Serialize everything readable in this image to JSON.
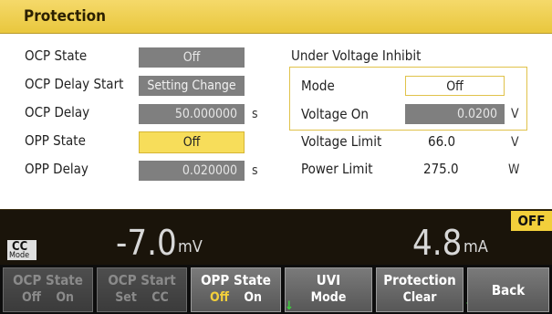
{
  "title": "Protection",
  "left": {
    "ocp_state": {
      "label": "OCP State",
      "value": "Off"
    },
    "ocp_delay_start": {
      "label": "OCP Delay Start",
      "value": "Setting Change"
    },
    "ocp_delay": {
      "label": "OCP Delay",
      "value": "50.000000",
      "unit": "s"
    },
    "opp_state": {
      "label": "OPP State",
      "value": "Off"
    },
    "opp_delay": {
      "label": "OPP Delay",
      "value": "0.020000",
      "unit": "s"
    }
  },
  "uvi": {
    "heading": "Under Voltage Inhibit",
    "mode": {
      "label": "Mode",
      "value": "Off"
    },
    "voltage_on": {
      "label": "Voltage On",
      "value": "0.0200",
      "unit": "V"
    },
    "voltage_limit": {
      "label": "Voltage Limit",
      "value": "66.0",
      "unit": "V"
    },
    "power_limit": {
      "label": "Power Limit",
      "value": "275.0",
      "unit": "W"
    }
  },
  "meter": {
    "mode_top": "CC",
    "mode_bottom": "Mode",
    "voltage": "-7.0",
    "voltage_unit": "mV",
    "current": "4.8",
    "current_unit": "mA",
    "output_state": "OFF"
  },
  "softkeys": [
    {
      "line1": "OCP State",
      "line2a": "Off",
      "line2b": "On"
    },
    {
      "line1": "OCP Start",
      "line2a": "Set",
      "line2b": "CC"
    },
    {
      "line1": "OPP State",
      "line2a": "Off",
      "line2b": "On"
    },
    {
      "line1": "UVI",
      "line2": "Mode"
    },
    {
      "line1": "Protection",
      "line2": "Clear"
    },
    {
      "line1": "Back"
    }
  ],
  "colors": {
    "accent_yellow": "#f2cf3b",
    "field_gray": "#7f7f7f",
    "arrow_green": "#3cd23c"
  },
  "icons": {
    "down_arrow": "↓",
    "up_arrow": "↑"
  }
}
